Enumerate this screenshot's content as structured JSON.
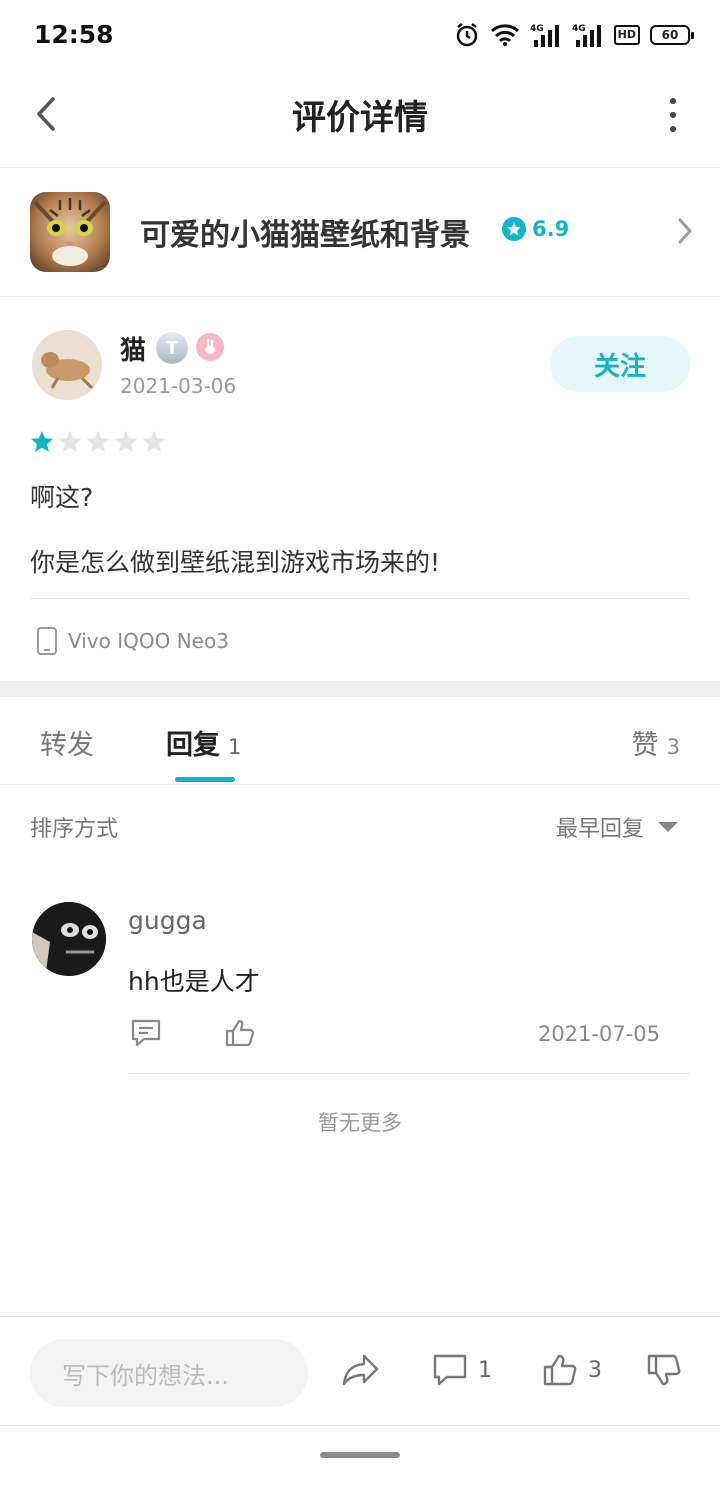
{
  "status_bar": {
    "time": "12:58",
    "network_4g_1": "4G",
    "network_4g_2": "4G",
    "hd_label": "HD",
    "battery": "60"
  },
  "nav": {
    "title": "评价详情"
  },
  "app": {
    "name": "可爱的小猫猫壁纸和背景",
    "rating": "6.9"
  },
  "review": {
    "user_name": "猫",
    "level_badge": "T",
    "date": "2021-03-06",
    "follow_label": "关注",
    "stars": 1,
    "max_stars": 5,
    "line1": "啊这?",
    "line2": "你是怎么做到壁纸混到游戏市场来的!",
    "device": "Vivo IQOO Neo3"
  },
  "tabs": {
    "forward_label": "转发",
    "reply_label": "回复",
    "reply_count": "1",
    "like_label": "赞",
    "like_count": "3"
  },
  "sort": {
    "label": "排序方式",
    "selected": "最早回复"
  },
  "comments": [
    {
      "name": "gugga",
      "text": "hh也是人才",
      "date": "2021-07-05"
    }
  ],
  "no_more_text": "暂无更多",
  "bottom_bar": {
    "input_placeholder": "写下你的想法...",
    "comment_count": "1",
    "like_count": "3"
  },
  "colors": {
    "accent": "#15b3c6",
    "follow_bg": "#e6f7f9"
  }
}
